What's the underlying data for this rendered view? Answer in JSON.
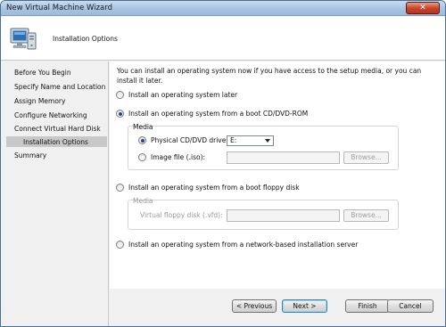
{
  "window": {
    "title": "New Virtual Machine Wizard",
    "close_glyph": "✕"
  },
  "header": {
    "icon": "computer-monitor-icon",
    "title": "Installation Options"
  },
  "nav": {
    "items": [
      {
        "label": "Before You Begin"
      },
      {
        "label": "Specify Name and Location"
      },
      {
        "label": "Assign Memory"
      },
      {
        "label": "Configure Networking"
      },
      {
        "label": "Connect Virtual Hard Disk"
      },
      {
        "label": "Installation Options",
        "selected": true
      },
      {
        "label": "Summary"
      }
    ]
  },
  "content": {
    "intro": "You can install an operating system now if you have access to the setup media, or you can install it later.",
    "options": [
      {
        "label": "Install an operating system later",
        "checked": false
      },
      {
        "label": "Install an operating system from a boot CD/DVD-ROM",
        "checked": true
      },
      {
        "label": "Install an operating system from a boot floppy disk",
        "checked": false
      },
      {
        "label": "Install an operating system from a network-based installation server",
        "checked": false
      }
    ],
    "cd_media": {
      "title": "Media",
      "physical_label": "Physical CD/DVD drive:",
      "physical_value": "E:",
      "image_label": "Image file (.iso):",
      "image_value": "",
      "browse_label": "Browse..."
    },
    "floppy_media": {
      "title": "Media",
      "vfd_label": "Virtual floppy disk (.vfd):",
      "vfd_value": "",
      "browse_label": "Browse..."
    }
  },
  "footer": {
    "previous": "< Previous",
    "next": "Next >",
    "finish": "Finish",
    "cancel": "Cancel"
  },
  "colors": {
    "title_bar": "#a7c4e3",
    "close_button": "#c9452b",
    "nav_selected": "#c8c8c8",
    "default_button_border": "#3c7fb1"
  }
}
